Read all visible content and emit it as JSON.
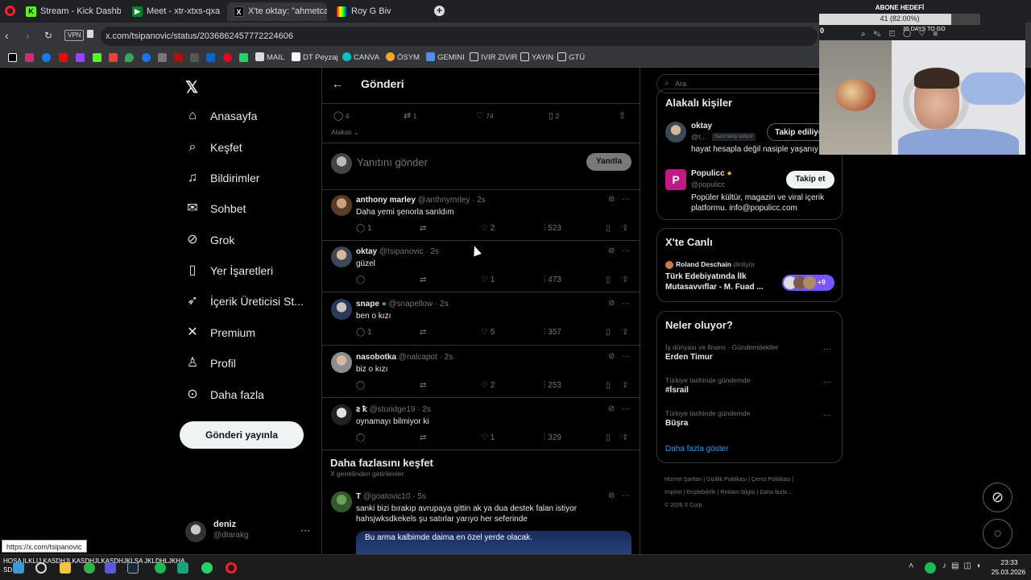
{
  "browser": {
    "tabs": [
      {
        "label": "Stream - Kick Dashboard",
        "icon": "kick-icon"
      },
      {
        "label": "Meet - xtr-xtxs-qxa",
        "icon": "meet-icon"
      },
      {
        "label": "X'te oktay: \"ahmetcan ka",
        "icon": "x-icon"
      },
      {
        "label": "Roy G Biv",
        "icon": "rgb-icon"
      }
    ],
    "url": "x.com/tsipanovic/status/2036862457772224606",
    "vpn_label": "VPN",
    "bookmarks": [
      "MAIL",
      "DT Peyzaj",
      "CANVA",
      "ÖSYM",
      "GEMINI",
      "IVIR ZIVIR",
      "YAYIN",
      "GTÜ"
    ]
  },
  "overlay": {
    "goal_title": "ABONE HEDEFİ",
    "goal_value": "41 (82.00%)",
    "goal_days": "35 DAYS TO GO",
    "goal_zero": "0"
  },
  "sidebar": {
    "items": [
      {
        "label": "Anasayfa",
        "icon": "home-icon"
      },
      {
        "label": "Keşfet",
        "icon": "search-icon"
      },
      {
        "label": "Bildirimler",
        "icon": "bell-icon"
      },
      {
        "label": "Sohbet",
        "icon": "mail-icon"
      },
      {
        "label": "Grok",
        "icon": "grok-icon"
      },
      {
        "label": "Yer İşaretleri",
        "icon": "bookmark-icon"
      },
      {
        "label": "İçerik Üreticisi St...",
        "icon": "rocket-icon"
      },
      {
        "label": "Premium",
        "icon": "x-logo-icon"
      },
      {
        "label": "Profil",
        "icon": "person-icon"
      },
      {
        "label": "Daha fazla",
        "icon": "more-circle-icon"
      }
    ],
    "post_button": "Gönderi yayınla",
    "account": {
      "name": "deniz",
      "handle": "@dtarakg"
    }
  },
  "main": {
    "title": "Gönderi",
    "post_stats": {
      "replies": "4",
      "reposts": "1",
      "likes": "74",
      "bookmarks": "2"
    },
    "sort_label": "Alakalı",
    "reply_placeholder": "Yanıtını gönder",
    "reply_button": "Yanıtla",
    "replies": [
      {
        "name": "anthony marley",
        "handle": "@anthnymrley · 2s",
        "text": "Daha yemi şenorla sarıldım",
        "replies": "1",
        "likes": "2",
        "views": "523"
      },
      {
        "name": "oktay",
        "handle": "@tsipanovic · 2s",
        "text": "güzel",
        "replies": "",
        "likes": "1",
        "views": "473"
      },
      {
        "name": "snape",
        "handle": "@snapellow · 2s",
        "text": "ben o kızı",
        "replies": "1",
        "likes": "5",
        "views": "357"
      },
      {
        "name": "nasobotka",
        "handle": "@nalcapot · 2s",
        "text": "biz o kızı",
        "replies": "",
        "likes": "2",
        "views": "253"
      },
      {
        "name": "ꙅ ꝁ",
        "handle": "@sturidge19 · 2s",
        "text": "oynamayı bilmiyor ki",
        "replies": "",
        "likes": "1",
        "views": "329"
      }
    ],
    "discover_title": "Daha fazlasını keşfet",
    "discover_subtitle": "X genelinden getirilenler",
    "discover_post": {
      "name": "T",
      "handle": "@goatovic10 · 5s",
      "text": "sanki bizi bırakıp avrupaya gittin ak ya dua destek falan istiyor hahsjwksdkekels şu satırlar yarıyo her seferinde",
      "media_text": "Bu arma kalbimde daima en özel yerde olacak."
    }
  },
  "right": {
    "search_placeholder": "Ara",
    "related_title": "Alakalı kişiler",
    "people": [
      {
        "name": "oktay",
        "handle": "@t...",
        "badge": "Seni takip ediyor",
        "bio": "hayat hesapla değil nasiple yaşanıy",
        "button": "Takip ediliyor"
      },
      {
        "name": "Populicc",
        "handle": "@populicc",
        "badge": "",
        "bio": "Popüler kültür, magazin ve viral içerik platformu. info@populicc.com",
        "button": "Takip et"
      }
    ],
    "live_title": "X'te Canlı",
    "live_host": "Roland Deschain",
    "live_status": "dinliyor",
    "live_topic": "Türk Edebiyatında İlk Mutasavvıflar - M. Fuad ...",
    "live_count": "+9",
    "trends_title": "Neler oluyor?",
    "trends": [
      {
        "context": "İş dünyası ve finans · Gündemdekiler",
        "name": "Erden Timur"
      },
      {
        "context": "Türkiye tarihinde gündemde",
        "name": "#İsrail"
      },
      {
        "context": "Türkiye tarihinde gündemde",
        "name": "Büşra"
      }
    ],
    "show_more": "Daha fazla göster",
    "footer": [
      "Hizmet Şartları",
      "Gizlilik Politikası",
      "Çerez Politikası",
      "Imprint",
      "Erişilebilirlik",
      "Reklam bilgisi",
      "Daha fazla ...",
      "© 2026 X Corp."
    ]
  },
  "status_url": "https://x.com/tsipanovic",
  "taskbar": {
    "ticker": "HOSA ILKLIJ KASDHJLKASDHJLKASDHJKLSA JKLDHLJKHA",
    "ticker2": "SD",
    "time": "23:33",
    "date": "25.03.2026"
  }
}
